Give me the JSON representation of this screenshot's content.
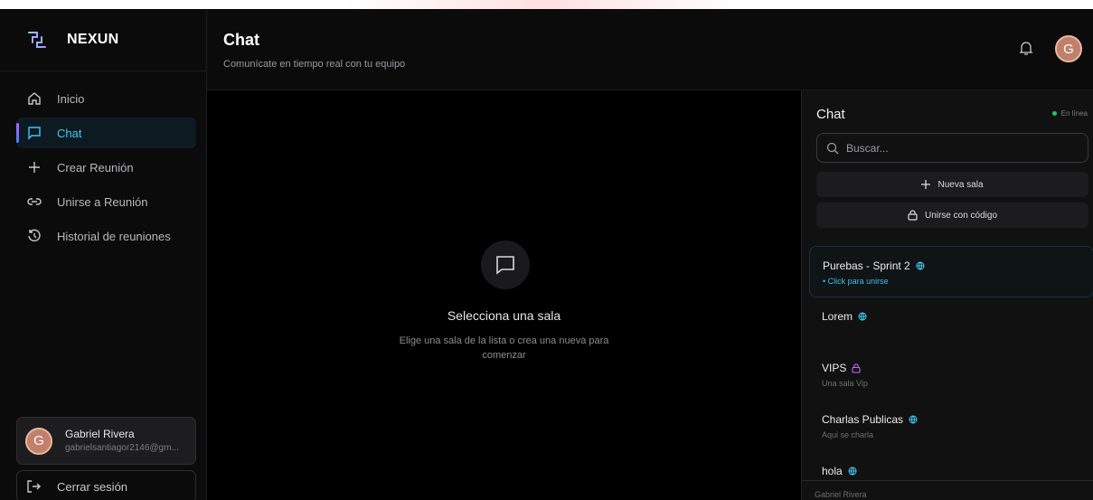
{
  "brand": {
    "name": "NEXUN"
  },
  "sidebar": {
    "items": [
      {
        "label": "Inicio",
        "icon": "home-icon"
      },
      {
        "label": "Chat",
        "icon": "message-square-icon"
      },
      {
        "label": "Crear Reunión",
        "icon": "plus-icon"
      },
      {
        "label": "Unirse a Reunión",
        "icon": "link-icon"
      },
      {
        "label": "Historial de reuniones",
        "icon": "history-icon"
      }
    ],
    "active_index": 1,
    "user": {
      "initial": "G",
      "name": "Gabriel Rivera",
      "email": "gabrielsantiagor2146@gm..."
    },
    "logout_label": "Cerrar sesión"
  },
  "header": {
    "title": "Chat",
    "subtitle": "Comunícate en tiempo real con tu equipo",
    "avatar_initial": "G"
  },
  "main": {
    "empty_title": "Selecciona una sala",
    "empty_text": "Elige una sala de la lista o crea una nueva para comenzar"
  },
  "chat_panel": {
    "title": "Chat",
    "status": "En línea",
    "search_placeholder": "Buscar...",
    "new_room_label": "Nueva sala",
    "join_code_label": "Unirse con código",
    "rooms": [
      {
        "name": "Purebas - Sprint 2",
        "type": "public",
        "subtitle": "• Click para unirse"
      },
      {
        "name": "Lorem",
        "type": "public",
        "subtitle": ""
      },
      {
        "name": "VIPS",
        "type": "private",
        "subtitle": "Una sala Vip"
      },
      {
        "name": "Charlas Publicas",
        "type": "public",
        "subtitle": "Aqui se charla"
      },
      {
        "name": "hola",
        "type": "public",
        "subtitle": ""
      }
    ],
    "footer_user": "Gabriel Rivera"
  },
  "colors": {
    "accent": "#43c7f0",
    "online": "#22c55e",
    "private": "#c06bff",
    "avatar": "#c0806b"
  }
}
